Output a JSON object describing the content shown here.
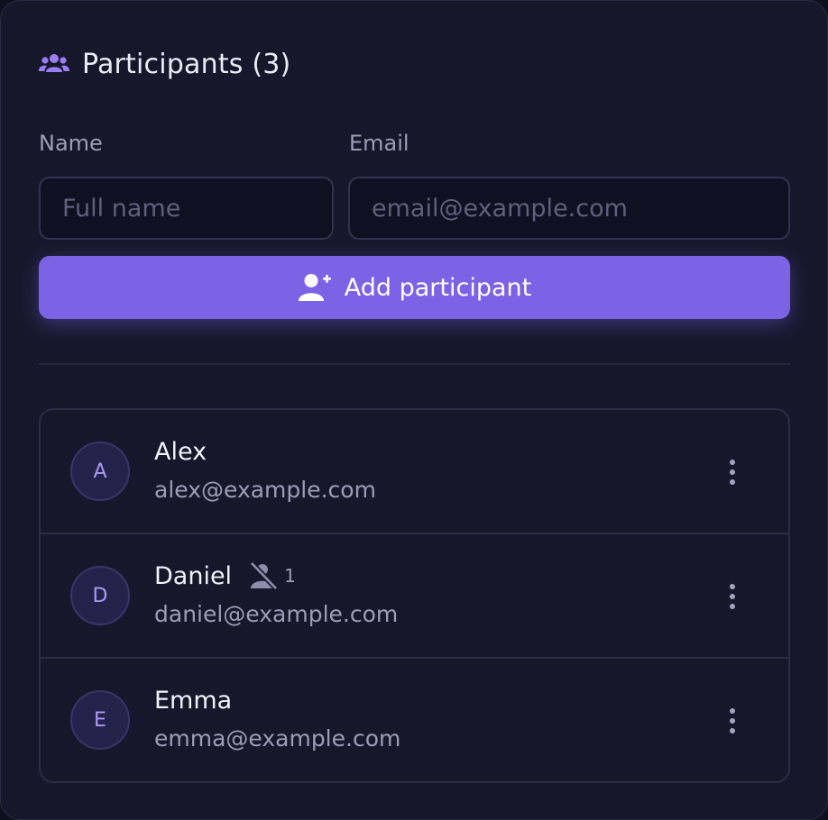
{
  "header": {
    "title": "Participants (3)"
  },
  "form": {
    "name_label": "Name",
    "name_placeholder": "Full name",
    "name_value": "",
    "email_label": "Email",
    "email_placeholder": "email@example.com",
    "email_value": "",
    "add_button_label": "Add participant"
  },
  "participants": [
    {
      "initial": "A",
      "name": "Alex",
      "email": "alex@example.com"
    },
    {
      "initial": "D",
      "name": "Daniel",
      "email": "daniel@example.com",
      "exclusion_icon": "person-off-icon",
      "exclusion_count": "1"
    },
    {
      "initial": "E",
      "name": "Emma",
      "email": "emma@example.com"
    }
  ],
  "icons": {
    "header": "users-icon",
    "add_button": "user-plus-icon",
    "row_menu": "more-vertical-icon"
  },
  "colors": {
    "accent": "#7c63e6",
    "panel_bg": "#17172c",
    "text_primary": "#f2f2fa",
    "text_secondary": "#9c9cb8"
  }
}
